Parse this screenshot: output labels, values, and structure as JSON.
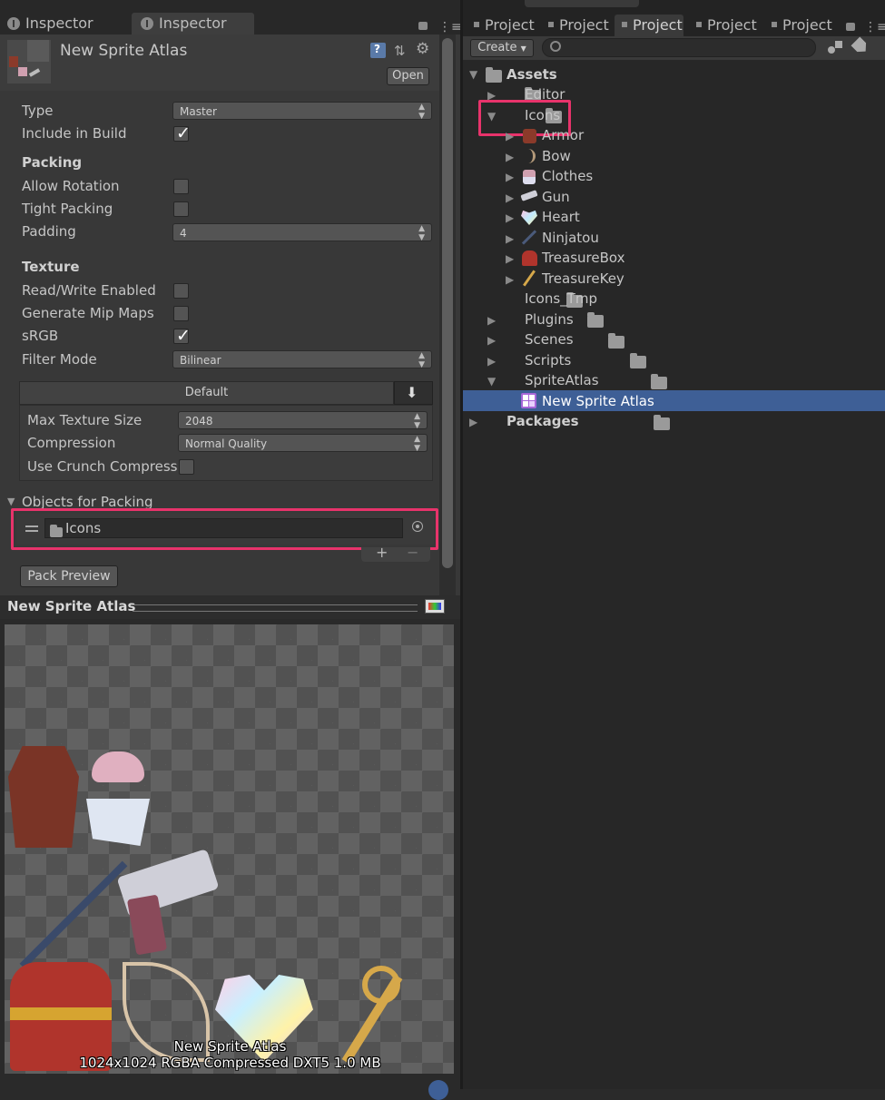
{
  "left": {
    "tabs": [
      "Inspector",
      "Inspector"
    ],
    "asset_name": "New Sprite Atlas",
    "open_button": "Open",
    "fields": {
      "type_label": "Type",
      "type_value": "Master",
      "include_label": "Include in Build",
      "include_checked": true,
      "packing_header": "Packing",
      "allow_rotation_label": "Allow Rotation",
      "tight_packing_label": "Tight Packing",
      "padding_label": "Padding",
      "padding_value": "4",
      "texture_header": "Texture",
      "rw_label": "Read/Write Enabled",
      "mip_label": "Generate Mip Maps",
      "srgb_label": "sRGB",
      "srgb_checked": true,
      "filter_label": "Filter Mode",
      "filter_value": "Bilinear"
    },
    "platform": {
      "tab_label": "Default",
      "max_tex_label": "Max Texture Size",
      "max_tex_value": "2048",
      "compression_label": "Compression",
      "compression_value": "Normal Quality",
      "crunch_label": "Use Crunch Compression"
    },
    "objects": {
      "header": "Objects for Packing",
      "item": "Icons",
      "plus": "+",
      "minus": "−"
    },
    "pack_preview": "Pack Preview",
    "preview": {
      "title": "New Sprite Atlas",
      "caption_name": "New Sprite Atlas",
      "caption_info": "1024x1024 RGBA Compressed DXT5   1.0 MB"
    }
  },
  "right": {
    "tabs": [
      "Project",
      "Project",
      "Project",
      "Project",
      "Project"
    ],
    "create_label": "Create",
    "tree": {
      "assets": "Assets",
      "editor": "Editor",
      "icons": "Icons",
      "armor": "Armor",
      "bow": "Bow",
      "clothes": "Clothes",
      "gun": "Gun",
      "heart": "Heart",
      "ninjatou": "Ninjatou",
      "treasurebox": "TreasureBox",
      "treasurekey": "TreasureKey",
      "icons_tmp": "Icons_Tmp",
      "plugins": "Plugins",
      "scenes": "Scenes",
      "scripts": "Scripts",
      "spriteatlas": "SpriteAtlas",
      "new_sprite_atlas": "New Sprite Atlas",
      "packages": "Packages"
    }
  },
  "colors": {
    "highlight": "#e8336b",
    "selection": "#3e5f96",
    "panel": "#383838"
  }
}
